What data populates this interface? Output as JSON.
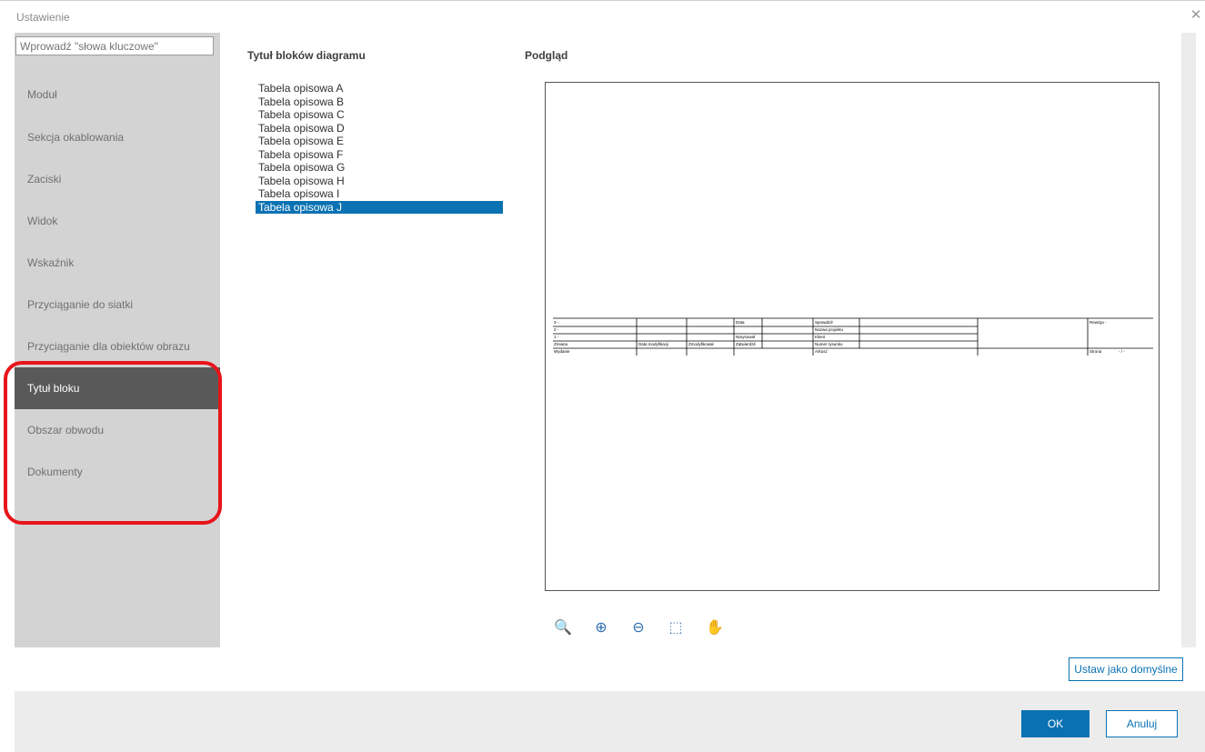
{
  "window": {
    "title": "Ustawienie",
    "close_glyph": "✕"
  },
  "search": {
    "placeholder": "Wprowadź \"słowa kluczowe\""
  },
  "sidebar": {
    "items": [
      {
        "label": "Moduł"
      },
      {
        "label": "Sekcja okablowania"
      },
      {
        "label": "Zaciski"
      },
      {
        "label": "Widok"
      },
      {
        "label": "Wskaźnik"
      },
      {
        "label": "Przyciąganie do siatki"
      },
      {
        "label": "Przyciąganie dla obiektów obrazu"
      },
      {
        "label": "Tytuł bloku",
        "active": true
      },
      {
        "label": "Obszar obwodu"
      },
      {
        "label": "Dokumenty"
      }
    ]
  },
  "main": {
    "list_heading": "Tytuł bloków diagramu",
    "preview_heading": "Podgląd",
    "list": [
      "Tabela opisowa A",
      "Tabela opisowa B",
      "Tabela opisowa C",
      "Tabela opisowa D",
      "Tabela opisowa E",
      "Tabela opisowa F",
      "Tabela opisowa G",
      "Tabela opisowa H",
      "Tabela opisowa I",
      "Tabela opisowa J"
    ],
    "selected_index": 9
  },
  "preview": {
    "cells": [
      "3 -",
      "2 -",
      "1 -",
      "Zmiana",
      "Wydanie",
      "Data modyfikacji",
      "Zmodyfikował",
      "Zatwierdził",
      "Data",
      "Narysował",
      "Sprawdził",
      "Nazwa projektu",
      "Klient",
      "Numer rysunku",
      "Arkusz",
      "Rewizja -",
      "Strona",
      "- / -"
    ]
  },
  "toolbar": {
    "tools": [
      {
        "name": "zoom-fit-icon",
        "glyph": "🔍"
      },
      {
        "name": "zoom-in-icon",
        "glyph": "⊕"
      },
      {
        "name": "zoom-out-icon",
        "glyph": "⊖"
      },
      {
        "name": "zoom-area-icon",
        "glyph": "⬚"
      },
      {
        "name": "pan-hand-icon",
        "glyph": "✋"
      }
    ]
  },
  "buttons": {
    "set_default": "Ustaw jako domyślne",
    "ok": "OK",
    "cancel": "Anuluj"
  },
  "colors": {
    "accent": "#0a72b3",
    "sidebar_active": "#595959",
    "highlight": "#e8141b"
  }
}
